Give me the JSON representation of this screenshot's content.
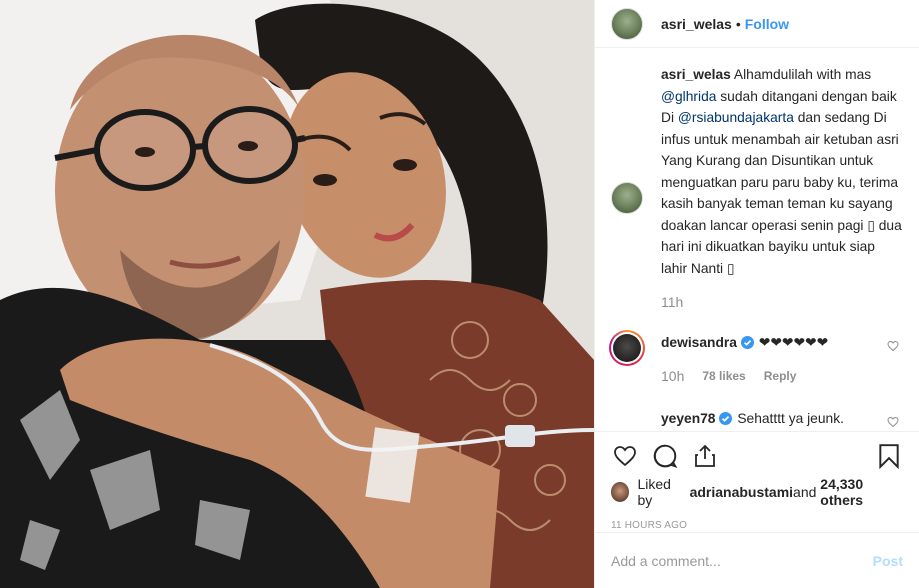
{
  "post": {
    "author": "asri_welas",
    "follow_label": "Follow",
    "separator": "•"
  },
  "caption": {
    "username": "asri_welas",
    "text_before": "Alhamdulilah with mas ",
    "mention1": "@glhrida",
    "text_mid1": " sudah ditangani dengan baik Di ",
    "mention2": "@rsiabundajakarta",
    "text_mid2": " dan sedang Di infus untuk menambah air ketuban asri Yang Kurang dan Disuntikan untuk menguatkan paru paru baby ku, terima kasih banyak teman teman ku sayang doakan lancar operasi senin pagi ",
    "emoji1": "▯",
    "text_mid3": " dua hari ini dikuatkan bayiku untuk siap lahir Nanti ",
    "emoji2": "▯",
    "time": "11h"
  },
  "comments": [
    {
      "username": "dewisandra",
      "text": "❤❤❤❤❤❤",
      "time": "10h",
      "likes": "78 likes",
      "reply": "Reply"
    },
    {
      "username": "yeyen78",
      "text": "Sehatttt ya jeunk."
    }
  ],
  "likes": {
    "prefix": "Liked by ",
    "user": "adrianabustami",
    "middle": " and ",
    "count": "24,330 others"
  },
  "timestamp": "11 HOURS AGO",
  "add_comment": {
    "placeholder": "Add a comment...",
    "post_label": "Post"
  },
  "icons": [
    "heart-icon",
    "comment-icon",
    "share-icon",
    "bookmark-icon",
    "verified-icon"
  ],
  "colors": {
    "link": "#3897f0",
    "mention": "#003569",
    "muted": "#8e8e8e",
    "post_disabled": "#b2dffc"
  }
}
